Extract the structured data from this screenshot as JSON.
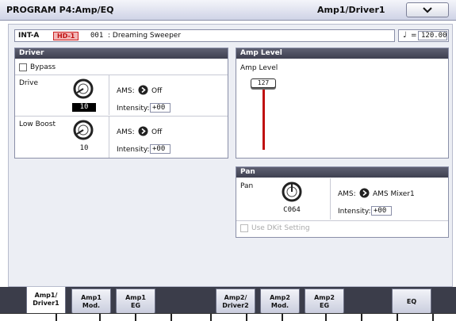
{
  "header": {
    "title": "PROGRAM P4:Amp/EQ",
    "page_label": "Amp1/Driver1",
    "menu_icon": "chevron-down-icon"
  },
  "program": {
    "bank": "INT-A",
    "badge": "HD-1",
    "number": "001",
    "name": ": Dreaming Sweeper"
  },
  "tempo": {
    "note_icon": "quarter-note-icon",
    "equals": "=",
    "value": "120.00"
  },
  "driver": {
    "title": "Driver",
    "bypass_label": "Bypass",
    "bypass_checked": false,
    "drive": {
      "label": "Drive",
      "value": "10",
      "ams_label": "AMS:",
      "ams_value": "Off",
      "intensity_label": "Intensity:",
      "intensity_value": "+00"
    },
    "low_boost": {
      "label": "Low Boost",
      "value": "10",
      "ams_label": "AMS:",
      "ams_value": "Off",
      "intensity_label": "Intensity:",
      "intensity_value": "+00"
    }
  },
  "amp_level": {
    "title": "Amp Level",
    "label": "Amp Level",
    "value": "127",
    "slider_fraction": 1.0
  },
  "pan": {
    "title": "Pan",
    "label": "Pan",
    "value": "C064",
    "ams_label": "AMS:",
    "ams_value": "AMS Mixer1",
    "intensity_label": "Intensity:",
    "intensity_value": "+00",
    "use_dkit_label": "Use DKit Setting",
    "use_dkit_checked": false
  },
  "tabs": [
    {
      "line1": "Amp1/",
      "line2": "Driver1",
      "active": true
    },
    {
      "line1": "Amp1",
      "line2": "Mod.",
      "active": false
    },
    {
      "line1": "Amp1",
      "line2": "EG",
      "active": false
    },
    {
      "line1": "Amp2/",
      "line2": "Driver2",
      "active": false
    },
    {
      "line1": "Amp2",
      "line2": "Mod.",
      "active": false
    },
    {
      "line1": "Amp2",
      "line2": "EG",
      "active": false
    },
    {
      "line1": "EQ",
      "line2": "",
      "active": false
    }
  ],
  "colors": {
    "accent_red": "#c01010",
    "header_dark": "#4a4c5c",
    "value_highlight": "#000000"
  }
}
